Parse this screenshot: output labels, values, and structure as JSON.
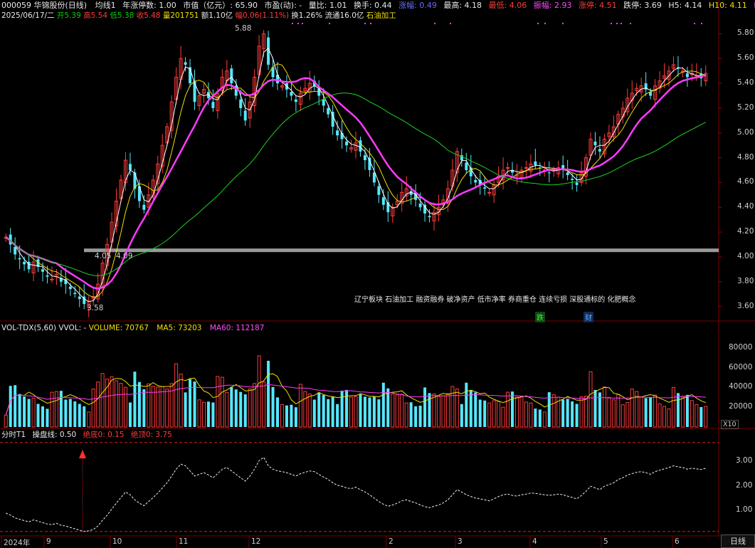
{
  "header": {
    "code_name": "000059 华锦股份(日线)",
    "ma_label": "均线1",
    "limit_days": "年涨停数: 1.00",
    "market_cap": "市值（亿元）: 65.90",
    "pe": "市盈(动): -",
    "vol_ratio": "量比: 1.01",
    "turnover": "换手: 0.44",
    "amplitude_5d": "涨幅: 0.49",
    "high_label": "最高: 4.18",
    "low_label": "最低: 4.06",
    "swing": "振幅: 2.93",
    "limit_up": "涨停: 4.51",
    "limit_down": "跌停: 3.69",
    "h5": "H5: 4.14",
    "h10": "H10: 4.11",
    "h2": "H2"
  },
  "ohlc_line": {
    "date": "2025/06/17/二",
    "open": "开5.39",
    "high": "高5.54",
    "low": "低5.38",
    "close": "收5.48",
    "volume": "量201751",
    "amount": "额1.10亿",
    "change": "幅0.06(1.11%)",
    "turnover": "换1.26%",
    "float": "流通16.0亿",
    "industry": "石油加工"
  },
  "price_axis": [
    "5.80",
    "5.60",
    "5.40",
    "5.20",
    "5.00",
    "4.80",
    "4.60",
    "4.40",
    "4.20",
    "4.00",
    "3.80",
    "3.60"
  ],
  "annotations": {
    "high_mark": "5.88",
    "low_mark": "3.58",
    "level_a": "4.05",
    "level_b": "4.09"
  },
  "concepts": "辽宁板块  石油加工  融资融券  破净资产  低市净率  券商重仓  连续亏损  深股通标的  化肥概念",
  "event_tags": {
    "die": "跌",
    "cai": "财"
  },
  "volume_panel": {
    "title": "VOL-TDX(5,60)",
    "vvol": "VVOL: -",
    "volume": "VOLUME: 70767",
    "ma5": "MA5: 73203",
    "ma60": "MA60: 112187",
    "axis": [
      "80000",
      "60000",
      "40000",
      "20000"
    ],
    "unit": "X10"
  },
  "indicator_panel": {
    "title": "分时T1",
    "line": "操盘线: 0.50",
    "bottom": "绝底0: 0.15",
    "top": "绝顶0: 3.75",
    "axis": [
      "3.00",
      "2.00",
      "1.00"
    ]
  },
  "time_axis": [
    "2024年",
    "9",
    "10",
    "11",
    "12",
    "2",
    "3",
    "4",
    "5",
    "6"
  ],
  "period_button": "日线",
  "colors": {
    "up": "#ff3b3b",
    "down": "#55e8ff",
    "ma_magenta": "#ff3bff",
    "ma_yellow": "#f0e000",
    "ma_white": "#ffffff",
    "ma_green": "#1ed21e",
    "grid": "#8b0000"
  },
  "chart_data": {
    "type": "candlestick",
    "ylim": [
      3.5,
      5.9
    ],
    "closes": [
      4.16,
      4.1,
      4.02,
      3.98,
      3.94,
      3.9,
      3.96,
      3.92,
      3.88,
      3.84,
      3.82,
      3.86,
      3.8,
      3.78,
      3.74,
      3.7,
      3.66,
      3.62,
      3.64,
      3.68,
      3.78,
      3.95,
      4.1,
      4.28,
      4.45,
      4.62,
      4.78,
      4.7,
      4.55,
      4.45,
      4.38,
      4.5,
      4.62,
      4.75,
      4.9,
      5.05,
      5.25,
      5.45,
      5.6,
      5.55,
      5.4,
      5.25,
      5.3,
      5.35,
      5.28,
      5.2,
      5.32,
      5.45,
      5.5,
      5.4,
      5.3,
      5.2,
      5.1,
      5.25,
      5.45,
      5.7,
      5.8,
      5.55,
      5.45,
      5.4,
      5.38,
      5.35,
      5.3,
      5.25,
      5.32,
      5.36,
      5.4,
      5.38,
      5.3,
      5.22,
      5.15,
      5.05,
      4.98,
      4.95,
      4.9,
      4.88,
      4.92,
      4.85,
      4.78,
      4.7,
      4.6,
      4.5,
      4.42,
      4.36,
      4.4,
      4.45,
      4.52,
      4.55,
      4.5,
      4.46,
      4.4,
      4.35,
      4.32,
      4.36,
      4.4,
      4.46,
      4.55,
      4.7,
      4.85,
      4.78,
      4.7,
      4.65,
      4.6,
      4.58,
      4.55,
      4.52,
      4.58,
      4.65,
      4.7,
      4.72,
      4.68,
      4.66,
      4.7,
      4.72,
      4.75,
      4.74,
      4.72,
      4.7,
      4.68,
      4.7,
      4.72,
      4.7,
      4.66,
      4.62,
      4.58,
      4.68,
      4.8,
      4.95,
      4.9,
      4.85,
      4.95,
      5.0,
      5.05,
      5.15,
      5.2,
      5.28,
      5.32,
      5.36,
      5.38,
      5.35,
      5.3,
      5.38,
      5.42,
      5.46,
      5.5,
      5.55,
      5.52,
      5.5,
      5.45,
      5.48,
      5.46,
      5.44,
      5.48
    ]
  }
}
